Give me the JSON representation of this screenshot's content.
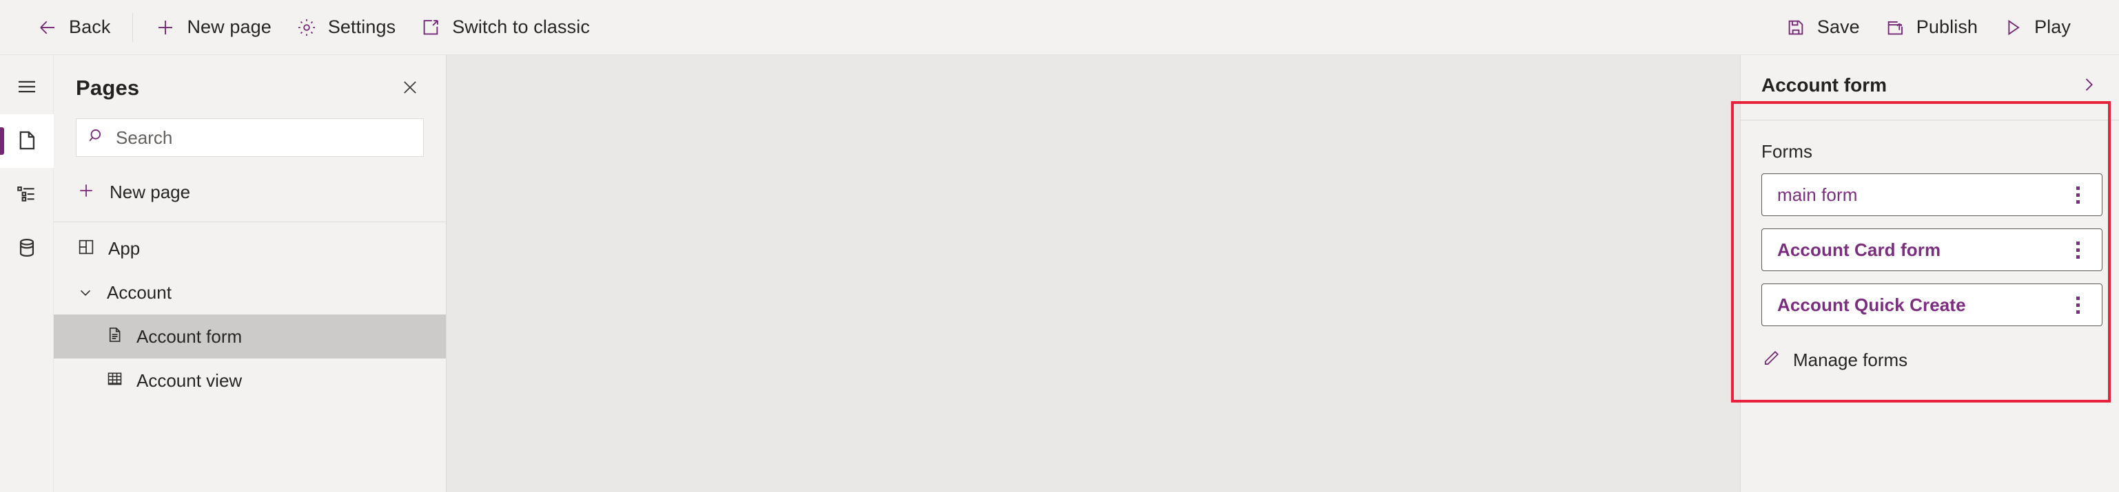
{
  "toolbar": {
    "left_items": [
      {
        "label": "Back",
        "icon": "arrow-left-icon"
      },
      {
        "label": "New page",
        "icon": "plus-icon"
      },
      {
        "label": "Settings",
        "icon": "gear-icon"
      },
      {
        "label": "Switch to classic",
        "icon": "external-link-icon"
      }
    ],
    "right_items": [
      {
        "label": "Save",
        "icon": "save-icon"
      },
      {
        "label": "Publish",
        "icon": "publish-icon"
      },
      {
        "label": "Play",
        "icon": "play-icon"
      }
    ]
  },
  "rail": {
    "items": [
      {
        "icon": "hamburger-menu-icon",
        "name": "menu",
        "active": false
      },
      {
        "icon": "page-icon",
        "name": "pages",
        "active": true
      },
      {
        "icon": "tree-view-icon",
        "name": "navigation",
        "active": false
      },
      {
        "icon": "database-icon",
        "name": "data",
        "active": false
      }
    ]
  },
  "pages_panel": {
    "title": "Pages",
    "close_icon": "close-icon",
    "search": {
      "placeholder": "Search",
      "value": "",
      "icon": "search-icon"
    },
    "new_page": {
      "label": "New page",
      "icon": "plus-icon"
    },
    "tree": [
      {
        "label": "App",
        "icon": "app-grid-icon",
        "indent": false,
        "selected": false,
        "chevron": ""
      },
      {
        "label": "Account",
        "icon": "",
        "indent": false,
        "selected": false,
        "chevron": "chevron-down-icon"
      },
      {
        "label": "Account form",
        "icon": "form-document-icon",
        "indent": true,
        "selected": true,
        "chevron": ""
      },
      {
        "label": "Account view",
        "icon": "table-grid-icon",
        "indent": true,
        "selected": false,
        "chevron": ""
      }
    ]
  },
  "properties_panel": {
    "title": "Account form",
    "collapse_icon": "chevron-right-icon",
    "section_label": "Forms",
    "forms": [
      {
        "label": "main form",
        "semibold": false,
        "menu_icon": "more-vertical-icon"
      },
      {
        "label": "Account Card form",
        "semibold": true,
        "menu_icon": "more-vertical-icon"
      },
      {
        "label": "Account Quick Create",
        "semibold": true,
        "menu_icon": "more-vertical-icon"
      }
    ],
    "manage_forms": {
      "label": "Manage forms",
      "icon": "pencil-edit-icon"
    }
  },
  "colors": {
    "accent_purple": "#742774",
    "link_purple": "#7b2e80",
    "annotation_red": "#e8213d",
    "text_primary": "#272524",
    "panel_bg": "#f3f2f1",
    "canvas_bg": "#e9e8e6",
    "selected_row": "#cdcbc9"
  }
}
